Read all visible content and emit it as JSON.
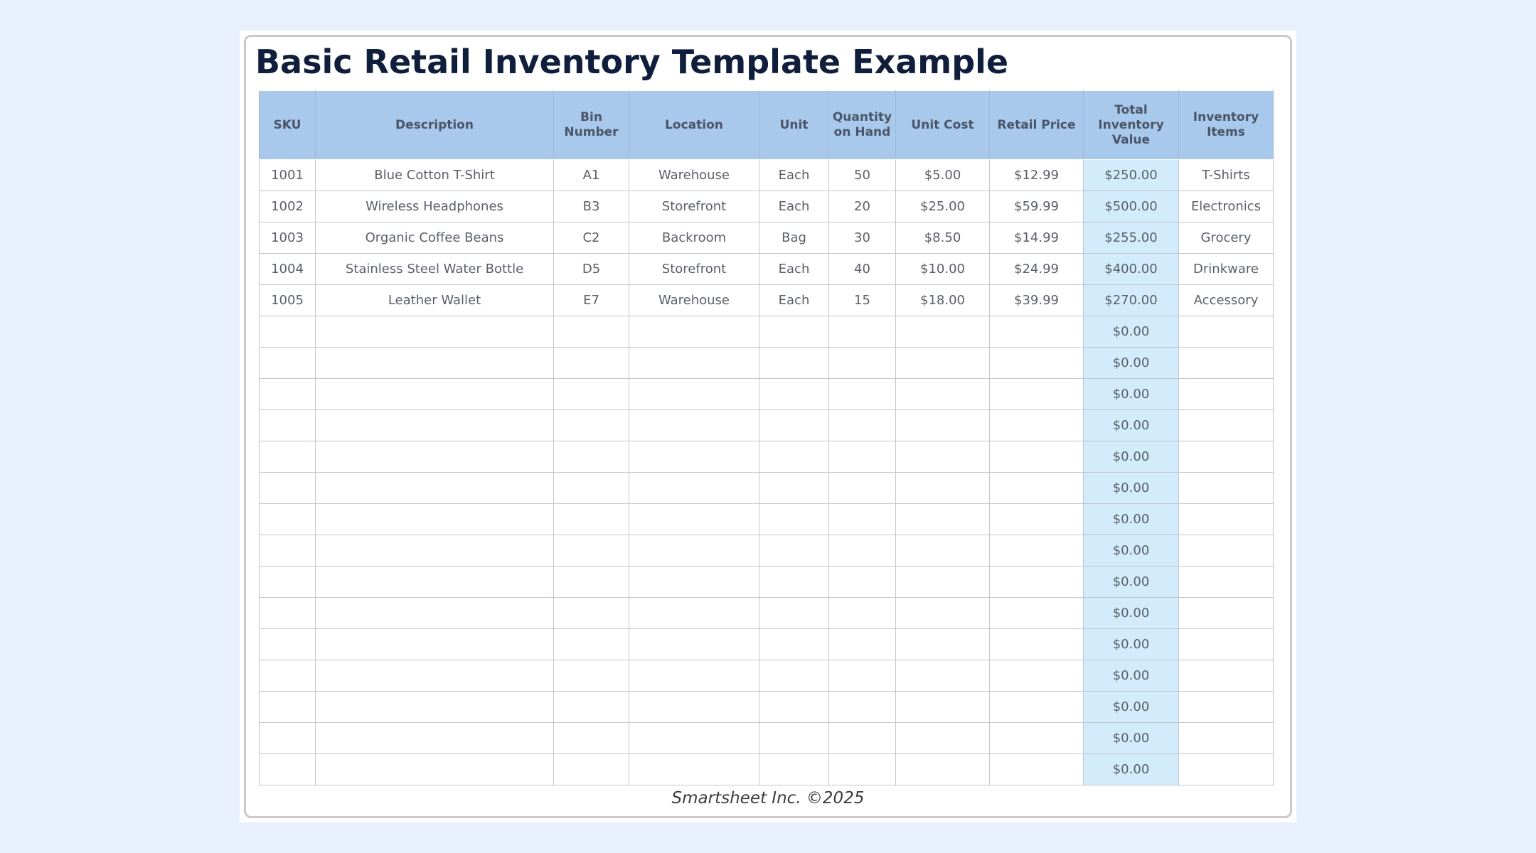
{
  "title": "Basic Retail Inventory Template Example",
  "columns": [
    "SKU",
    "Description",
    "Bin Number",
    "Location",
    "Unit",
    "Quantity on Hand",
    "Unit Cost",
    "Retail Price",
    "Total Inventory Value",
    "Inventory Items"
  ],
  "rows": [
    [
      "1001",
      "Blue Cotton T-Shirt",
      "A1",
      "Warehouse",
      "Each",
      "50",
      "$5.00",
      "$12.99",
      "$250.00",
      "T-Shirts"
    ],
    [
      "1002",
      "Wireless Headphones",
      "B3",
      "Storefront",
      "Each",
      "20",
      "$25.00",
      "$59.99",
      "$500.00",
      "Electronics"
    ],
    [
      "1003",
      "Organic Coffee Beans",
      "C2",
      "Backroom",
      "Bag",
      "30",
      "$8.50",
      "$14.99",
      "$255.00",
      "Grocery"
    ],
    [
      "1004",
      "Stainless Steel Water Bottle",
      "D5",
      "Storefront",
      "Each",
      "40",
      "$10.00",
      "$24.99",
      "$400.00",
      "Drinkware"
    ],
    [
      "1005",
      "Leather Wallet",
      "E7",
      "Warehouse",
      "Each",
      "15",
      "$18.00",
      "$39.99",
      "$270.00",
      "Accessory"
    ],
    [
      "",
      "",
      "",
      "",
      "",
      "",
      "",
      "",
      "$0.00",
      ""
    ],
    [
      "",
      "",
      "",
      "",
      "",
      "",
      "",
      "",
      "$0.00",
      ""
    ],
    [
      "",
      "",
      "",
      "",
      "",
      "",
      "",
      "",
      "$0.00",
      ""
    ],
    [
      "",
      "",
      "",
      "",
      "",
      "",
      "",
      "",
      "$0.00",
      ""
    ],
    [
      "",
      "",
      "",
      "",
      "",
      "",
      "",
      "",
      "$0.00",
      ""
    ],
    [
      "",
      "",
      "",
      "",
      "",
      "",
      "",
      "",
      "$0.00",
      ""
    ],
    [
      "",
      "",
      "",
      "",
      "",
      "",
      "",
      "",
      "$0.00",
      ""
    ],
    [
      "",
      "",
      "",
      "",
      "",
      "",
      "",
      "",
      "$0.00",
      ""
    ],
    [
      "",
      "",
      "",
      "",
      "",
      "",
      "",
      "",
      "$0.00",
      ""
    ],
    [
      "",
      "",
      "",
      "",
      "",
      "",
      "",
      "",
      "$0.00",
      ""
    ],
    [
      "",
      "",
      "",
      "",
      "",
      "",
      "",
      "",
      "$0.00",
      ""
    ],
    [
      "",
      "",
      "",
      "",
      "",
      "",
      "",
      "",
      "$0.00",
      ""
    ],
    [
      "",
      "",
      "",
      "",
      "",
      "",
      "",
      "",
      "$0.00",
      ""
    ],
    [
      "",
      "",
      "",
      "",
      "",
      "",
      "",
      "",
      "$0.00",
      ""
    ],
    [
      "",
      "",
      "",
      "",
      "",
      "",
      "",
      "",
      "$0.00",
      ""
    ]
  ],
  "footer": "Smartsheet Inc. ©2025",
  "colors": {
    "page_background": "#e8effd",
    "header_background": "#a8c8ec",
    "total_column_background": "#d2ecfb",
    "title_color": "#0f1e3c"
  }
}
